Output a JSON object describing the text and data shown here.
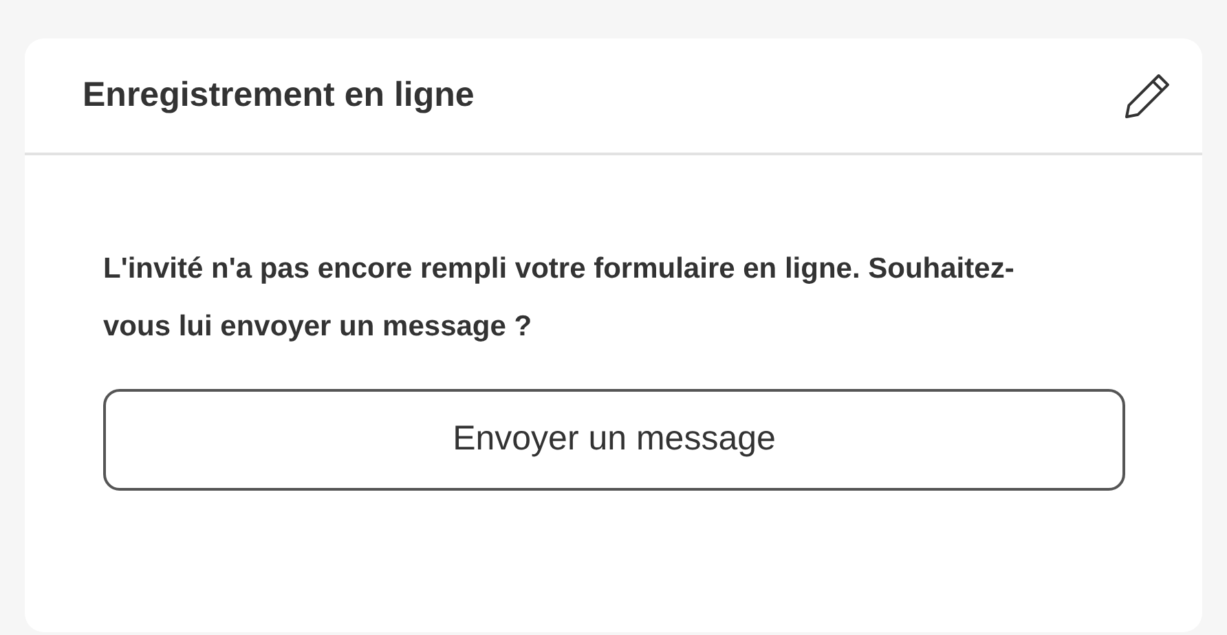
{
  "card": {
    "title": "Enregistrement en ligne",
    "message": "L'invité n'a pas encore rempli votre formulaire en ligne. Souhaitez-vous lui envoyer un message ?",
    "button": "Envoyer un message"
  }
}
